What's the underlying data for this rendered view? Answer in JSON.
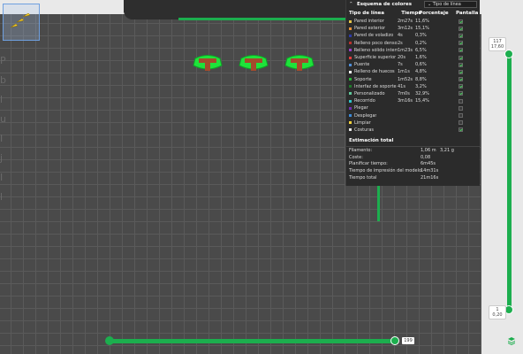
{
  "legend": {
    "title": "Esquema de colores",
    "scheme_select": "Tipo de línea",
    "columns": {
      "type": "Tipo de línea",
      "time": "Tiempo",
      "percent": "Porcentaje",
      "show": "Pantalla"
    },
    "rows": [
      {
        "label": "Pared interior",
        "time": "2m27s",
        "percent": "11,6%",
        "color": "#e6c64a",
        "shown": true
      },
      {
        "label": "Pared exterior",
        "time": "3m12s",
        "percent": "15,1%",
        "color": "#e9913a",
        "shown": true
      },
      {
        "label": "Pared de voladizo",
        "time": "4s",
        "percent": "0,3%",
        "color": "#2d3aa8",
        "shown": true
      },
      {
        "label": "Relleno poco denso",
        "time": "2s",
        "percent": "0,2%",
        "color": "#b8322e",
        "shown": true
      },
      {
        "label": "Relleno sólido interno",
        "time": "1m23s",
        "percent": "6,5%",
        "color": "#9a3fc9",
        "shown": true
      },
      {
        "label": "Superficie superior",
        "time": "20s",
        "percent": "1,6%",
        "color": "#e23b3b",
        "shown": true
      },
      {
        "label": "Puente",
        "time": "7s",
        "percent": "0,6%",
        "color": "#4f8ed8",
        "shown": true
      },
      {
        "label": "Relleno de huecos",
        "time": "1m1s",
        "percent": "4,8%",
        "color": "#ffffff",
        "shown": true
      },
      {
        "label": "Soporte",
        "time": "1m52s",
        "percent": "8,8%",
        "color": "#2ab43b",
        "shown": true
      },
      {
        "label": "Interfaz de soporte",
        "time": "41s",
        "percent": "3,2%",
        "color": "#1e7a2a",
        "shown": true
      },
      {
        "label": "Personalizado",
        "time": "7m0s",
        "percent": "32,9%",
        "color": "#5ec99a",
        "shown": true
      },
      {
        "label": "Recorrido",
        "time": "3m16s",
        "percent": "15,4%",
        "color": "#2fc4c8",
        "shown": false
      },
      {
        "label": "Plegar",
        "time": "",
        "percent": "",
        "color": "#6f2fb0",
        "shown": false
      },
      {
        "label": "Desplegar",
        "time": "",
        "percent": "",
        "color": "#3b8ad8",
        "shown": false
      },
      {
        "label": "Limpiar",
        "time": "",
        "percent": "",
        "color": "#f2d23a",
        "shown": false
      },
      {
        "label": "Costuras",
        "time": "",
        "percent": "",
        "color": "#e6e6e6",
        "shown": true
      }
    ]
  },
  "estimate": {
    "title": "Estimación total",
    "rows": [
      {
        "label": "Filamento:",
        "value": "1,06 m",
        "value2": "3,21 g"
      },
      {
        "label": "Coste:",
        "value": "0,08",
        "value2": ""
      },
      {
        "label": "Planificar tiempo:",
        "value": "6m45s",
        "value2": ""
      },
      {
        "label": "Tiempo de impresión del modelo:",
        "value": "14m31s",
        "value2": ""
      },
      {
        "label": "Tiempo total",
        "value": "21m16s",
        "value2": ""
      }
    ]
  },
  "horizontal_slider": {
    "value": "199"
  },
  "vertical_slider": {
    "top_layer": "117",
    "top_height": "17,60",
    "bottom_layer": "1",
    "bottom_height": "0,20"
  },
  "axis_text": "P\nb\nl\nu\nI\nj\nI\nl",
  "colors": {
    "accent": "#1cae4e",
    "panel_bg": "#2b2b2b",
    "viewport_bg": "#4a4a4a"
  }
}
